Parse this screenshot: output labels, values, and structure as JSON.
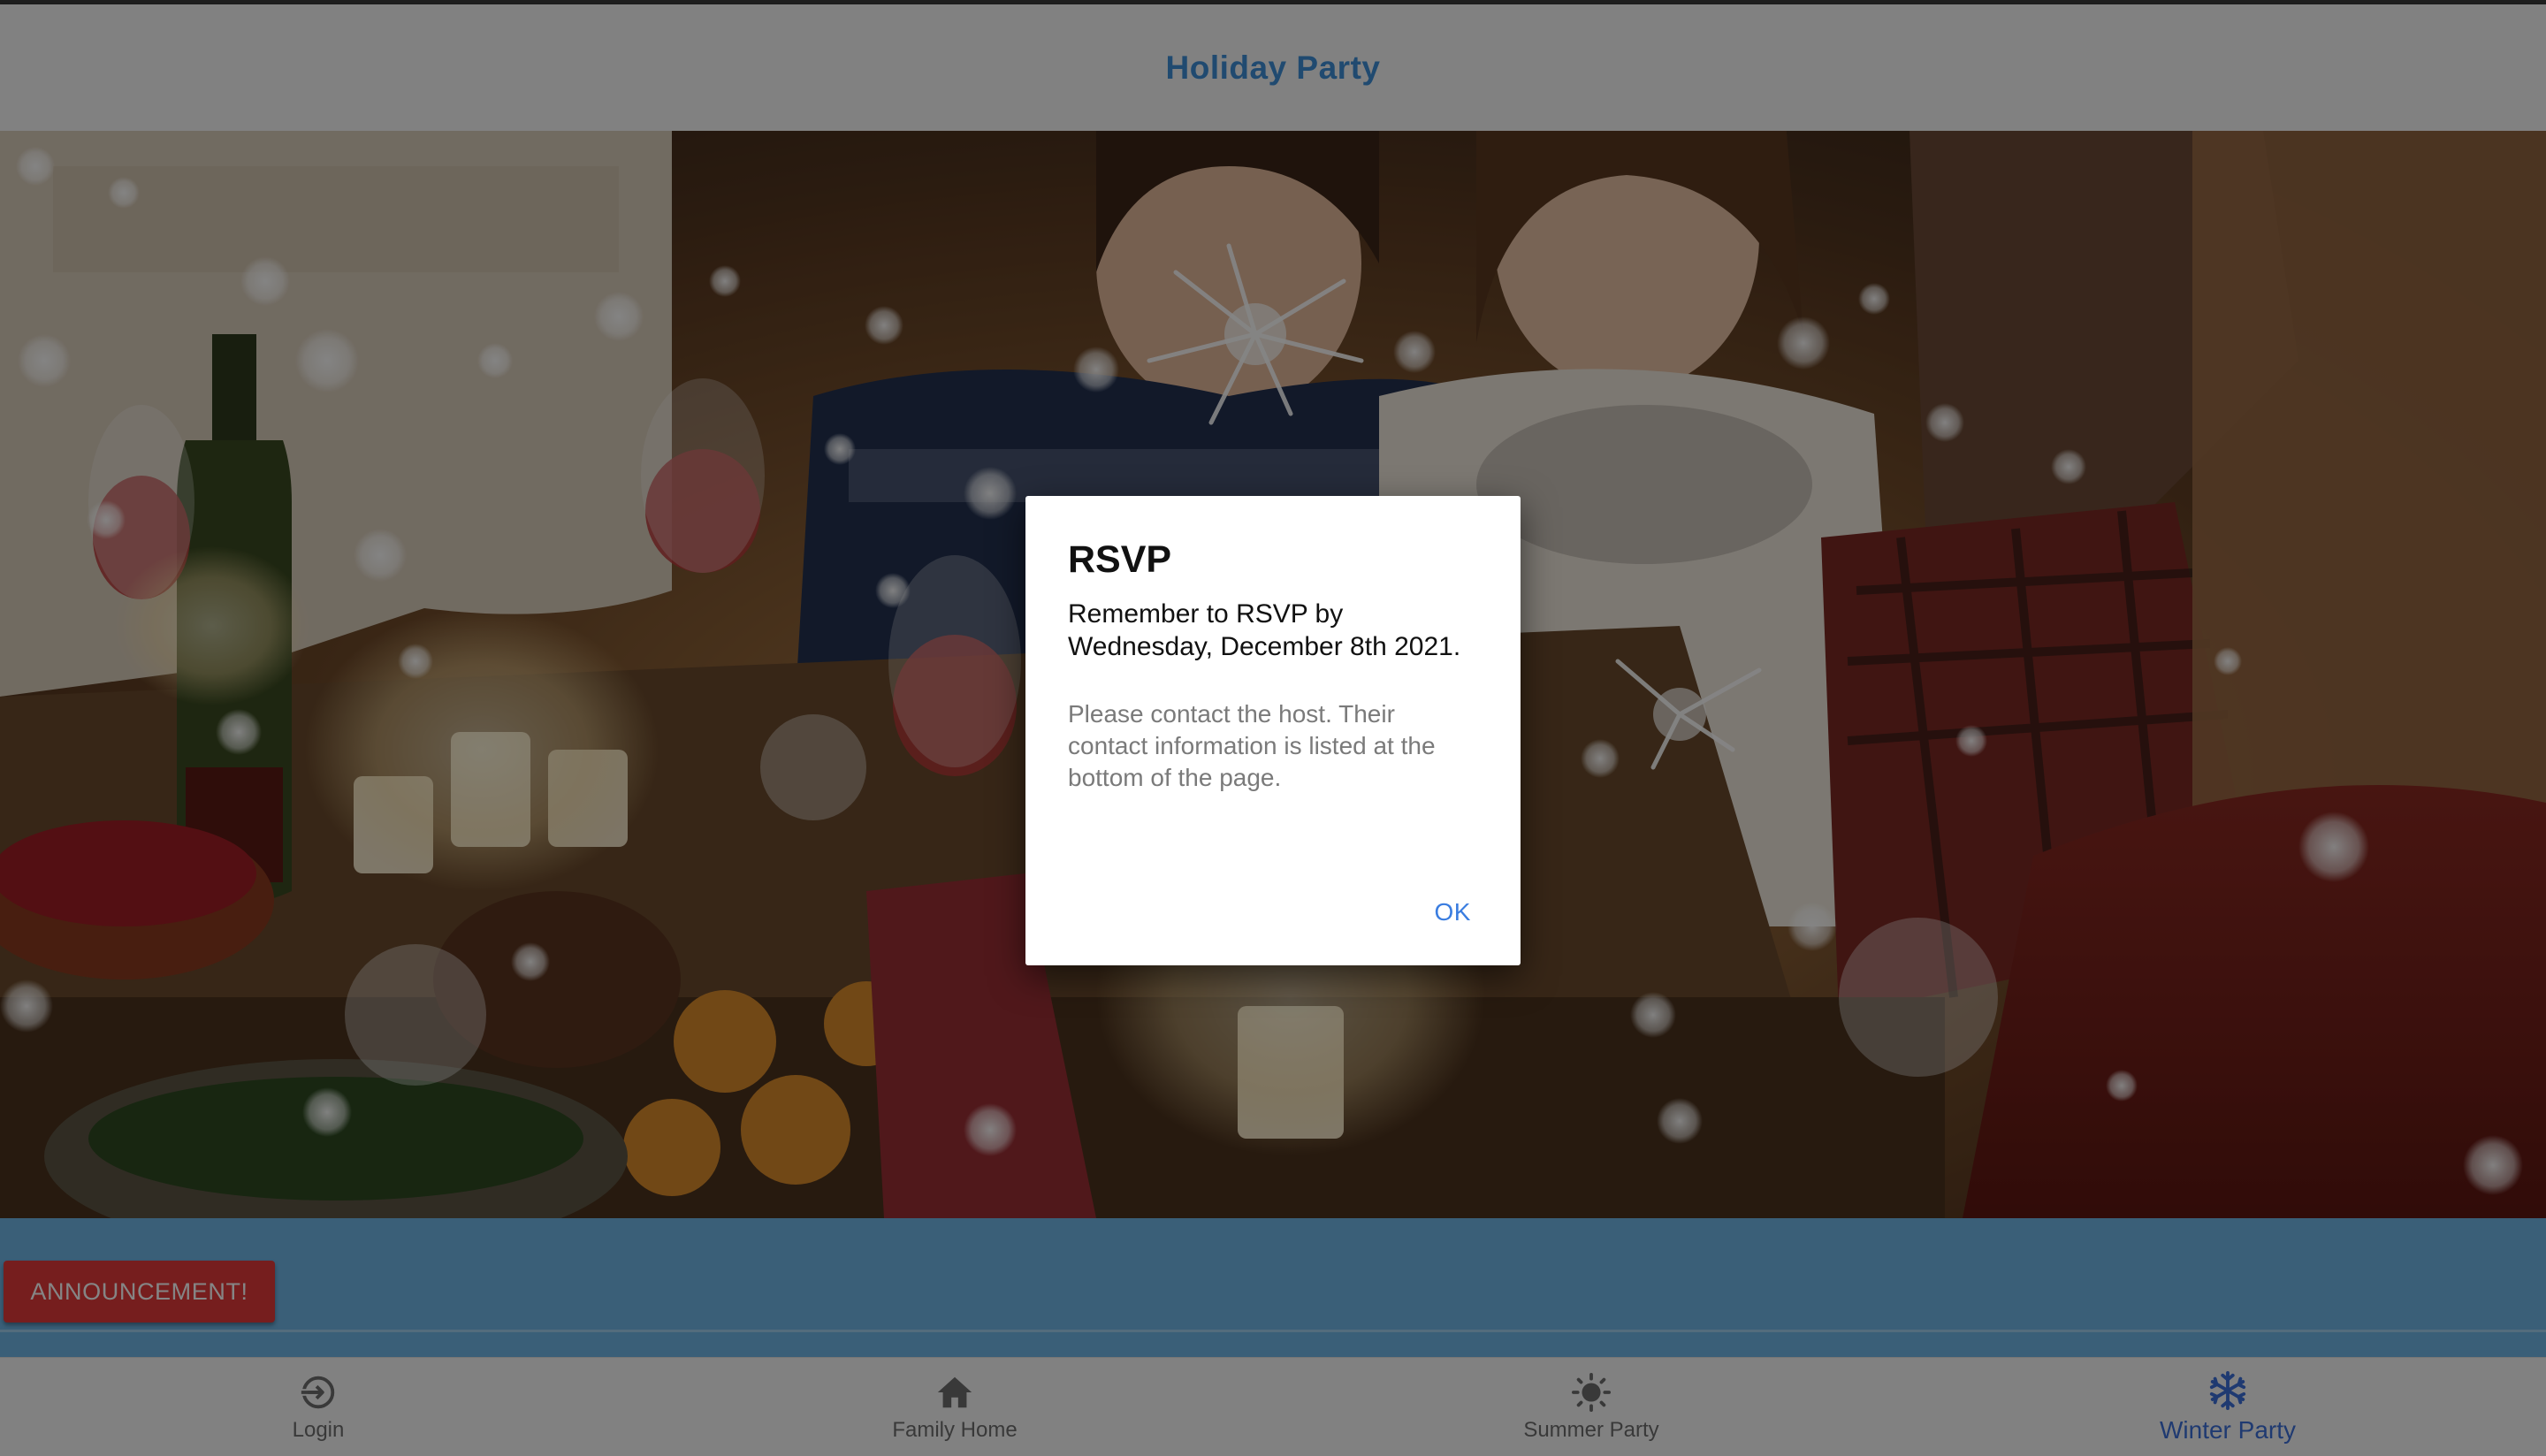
{
  "header": {
    "title": "Holiday Party"
  },
  "announcement": {
    "label": "ANNOUNCEMENT!"
  },
  "bottom_nav": {
    "items": [
      {
        "label": "Login",
        "icon": "login-icon",
        "active": false
      },
      {
        "label": "Family Home",
        "icon": "home-icon",
        "active": false
      },
      {
        "label": "Summer Party",
        "icon": "sun-icon",
        "active": false
      },
      {
        "label": "Winter Party",
        "icon": "snowflake-icon",
        "active": true
      }
    ]
  },
  "dialog": {
    "title": "RSVP",
    "message": "Remember to RSVP by Wednesday, December 8th 2021.",
    "submessage": "Please contact the host. Their contact information is listed at the bottom of the page.",
    "ok_label": "OK"
  },
  "colors": {
    "header_title": "#3f8fd6",
    "band": "#6fb6e6",
    "announcement_button": "#e23b3b",
    "active_nav": "#3d6fd9",
    "dialog_ok": "#3a7de0"
  }
}
